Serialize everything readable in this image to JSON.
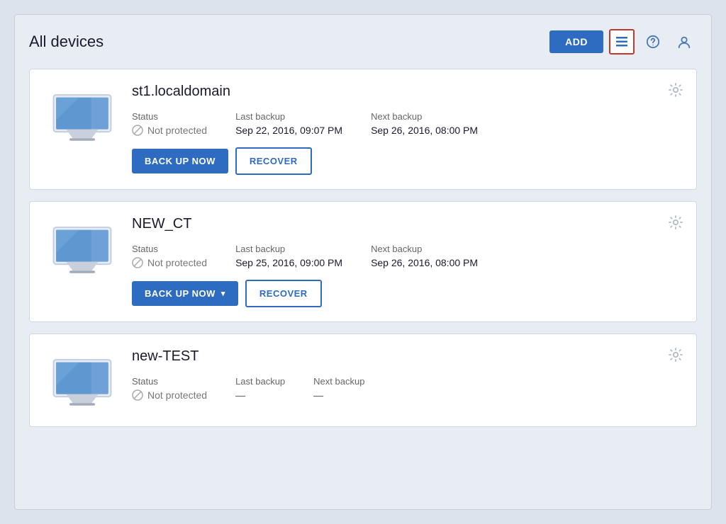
{
  "header": {
    "title": "All devices",
    "add_button_label": "ADD"
  },
  "devices": [
    {
      "id": "device-1",
      "name": "st1.localdomain",
      "status": "Not protected",
      "last_backup_label": "Last backup",
      "last_backup_value": "Sep 22, 2016, 09:07 PM",
      "next_backup_label": "Next backup",
      "next_backup_value": "Sep 26, 2016, 08:00 PM",
      "backup_button": "BACK UP NOW",
      "recover_button": "RECOVER",
      "has_dropdown": false
    },
    {
      "id": "device-2",
      "name": "NEW_CT",
      "status": "Not protected",
      "last_backup_label": "Last backup",
      "last_backup_value": "Sep 25, 2016, 09:00 PM",
      "next_backup_label": "Next backup",
      "next_backup_value": "Sep 26, 2016, 08:00 PM",
      "backup_button": "BACK UP NOW",
      "recover_button": "RECOVER",
      "has_dropdown": true
    },
    {
      "id": "device-3",
      "name": "new-TEST",
      "status": "Not protected",
      "last_backup_label": "Last backup",
      "last_backup_value": "—",
      "next_backup_label": "Next backup",
      "next_backup_value": "—",
      "backup_button": null,
      "recover_button": null,
      "has_dropdown": false
    }
  ],
  "icons": {
    "list_view": "list-view-icon",
    "help": "help-icon",
    "user": "user-icon",
    "gear": "gear-icon",
    "not_protected": "not-protected-icon",
    "chevron_down": "▾"
  }
}
